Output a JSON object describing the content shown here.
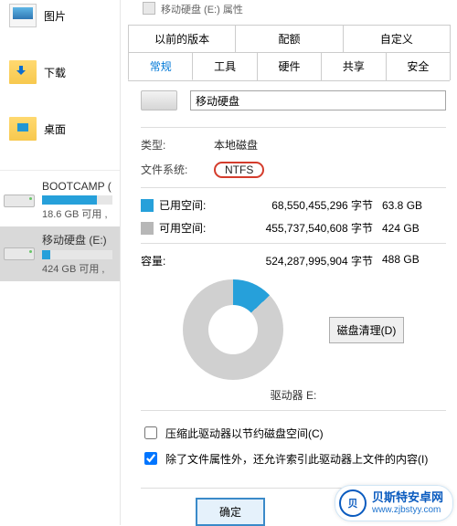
{
  "left": {
    "quick": [
      {
        "label": "图片"
      },
      {
        "label": "下载"
      },
      {
        "label": "桌面"
      }
    ],
    "drives": [
      {
        "name": "BOOTCAMP (",
        "free": "18.6 GB 可用 ,",
        "fill_pct": 78,
        "selected": false,
        "winlogo": true
      },
      {
        "name": "移动硬盘 (E:)",
        "free": "424 GB 可用 ,",
        "fill_pct": 12,
        "selected": true,
        "winlogo": false
      }
    ]
  },
  "dialog": {
    "title_hint": "移动硬盘 (E:) 属性",
    "tabs_row1": [
      "以前的版本",
      "配额",
      "自定义"
    ],
    "tabs_row2": [
      "常规",
      "工具",
      "硬件",
      "共享",
      "安全"
    ],
    "active_tab": "常规",
    "disk_name": "移动硬盘",
    "type_label": "类型:",
    "type_value": "本地磁盘",
    "fs_label": "文件系统:",
    "fs_value": "NTFS",
    "used_label": "已用空间:",
    "used_bytes": "68,550,455,296 字节",
    "used_human": "63.8 GB",
    "free_label": "可用空间:",
    "free_bytes": "455,737,540,608 字节",
    "free_human": "424 GB",
    "cap_label": "容量:",
    "cap_bytes": "524,287,995,904 字节",
    "cap_human": "488 GB",
    "drive_label": "驱动器 E:",
    "cleanup": "磁盘清理(D)",
    "chk_compress": "压缩此驱动器以节约磁盘空间(C)",
    "chk_index": "除了文件属性外，还允许索引此驱动器上文件的内容(I)",
    "ok": "确定"
  },
  "watermark": {
    "badge": "贝",
    "t1": "贝斯特安卓网",
    "t2": "www.zjbstyy.com"
  }
}
